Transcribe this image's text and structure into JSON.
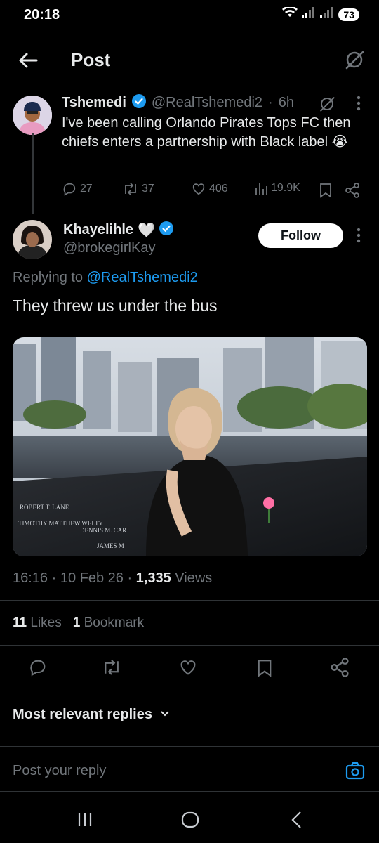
{
  "status": {
    "time": "20:18",
    "battery": "73"
  },
  "header": {
    "title": "Post"
  },
  "parent_post": {
    "name": "Tshemedi",
    "handle": "@RealTshemedi2",
    "time": "6h",
    "text": "I've been calling Orlando Pirates Tops FC then chiefs enters a partnership with Black label",
    "emoji": "😭",
    "replies": "27",
    "reposts": "37",
    "likes": "406",
    "views": "19.9K"
  },
  "main_post": {
    "name": "Khayelihle",
    "name_emoji": "🤍",
    "handle": "@brokegirlKay",
    "follow_label": "Follow",
    "replying_prefix": "Replying to",
    "replying_to": "@RealTshemedi2",
    "text": "They threw us under the bus",
    "photo_names": [
      "ROBERT T. LANE",
      "TIMOTHY MATTHEW WELTY",
      "DENNIS M. CAR",
      "JAMES M"
    ],
    "timestamp": "16:16 · 10 Feb 26 · ",
    "views_count": "1,335",
    "views_label": "Views",
    "likes_count": "11",
    "likes_label": "Likes",
    "bookmarks_count": "1",
    "bookmarks_label": "Bookmark"
  },
  "replies_section": {
    "sort_label": "Most relevant replies"
  },
  "reply_input": {
    "placeholder": "Post your reply"
  },
  "colors": {
    "accent": "#1d9bf0",
    "background": "#000000",
    "muted": "#71767b",
    "divider": "#2f3336"
  }
}
